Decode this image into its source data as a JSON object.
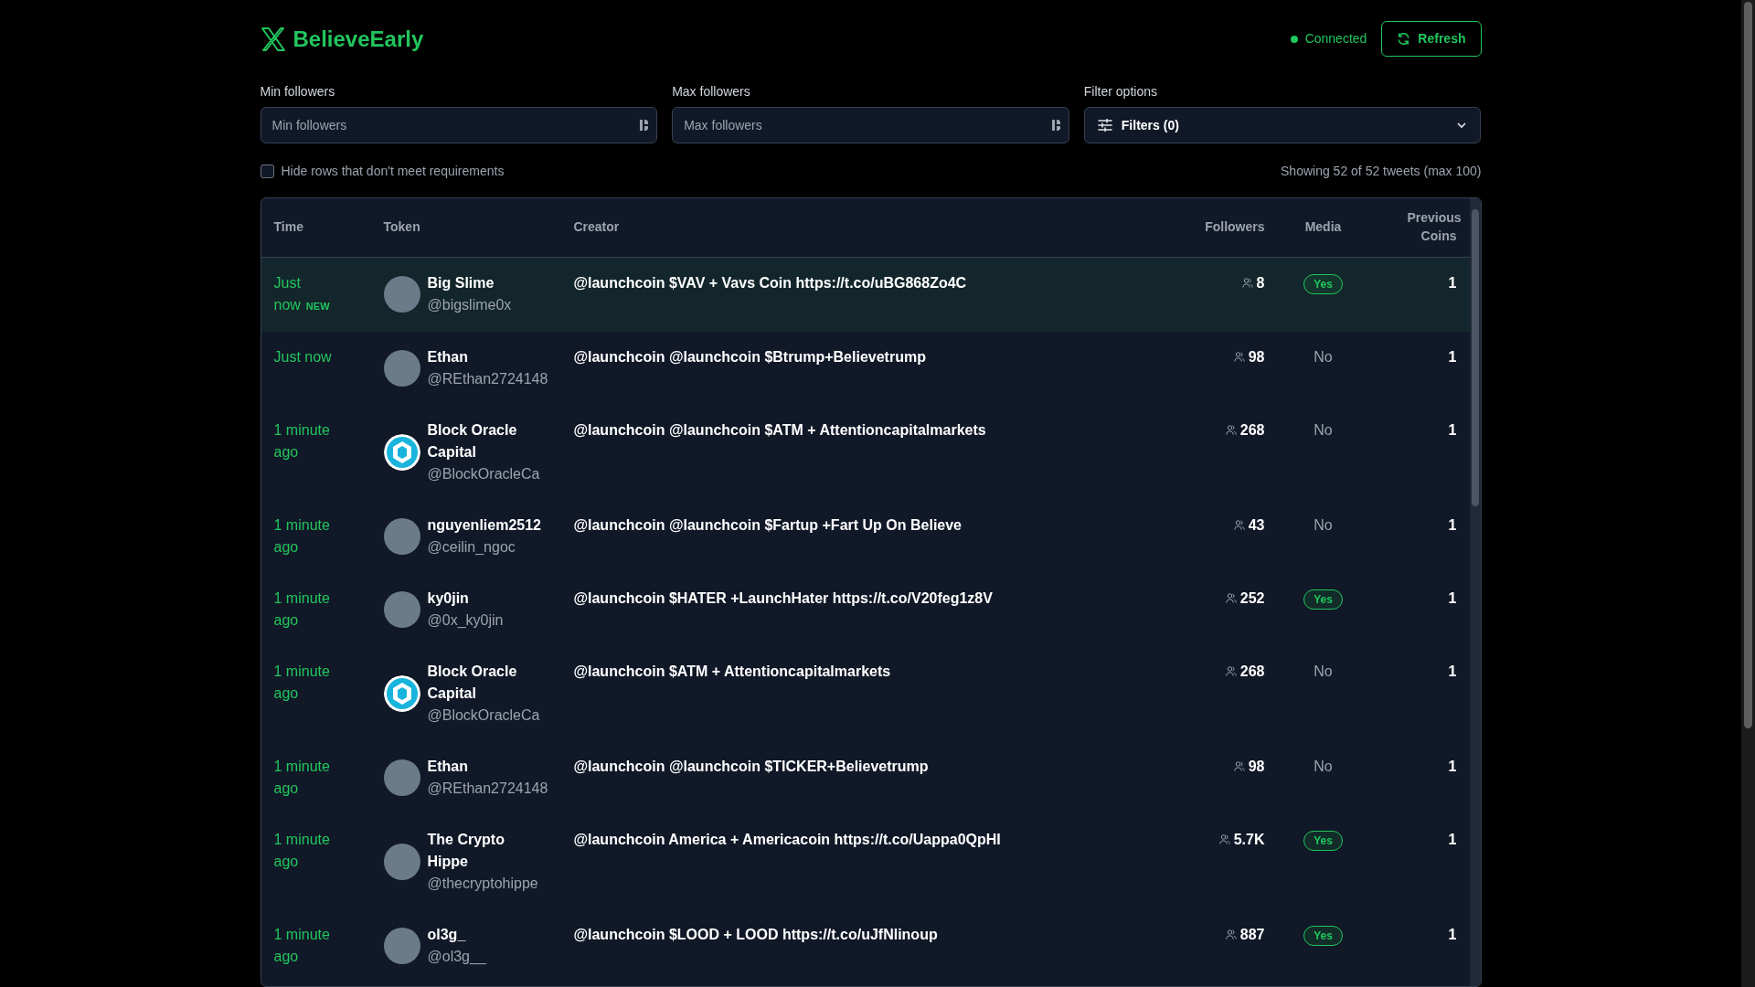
{
  "header": {
    "title": "BelieveEarly",
    "status": {
      "text": "Connected",
      "connected": true
    },
    "refresh_button": "Refresh"
  },
  "filters": [
    {
      "kind": "number",
      "label": "Min followers",
      "placeholder": "Min followers"
    },
    {
      "kind": "number",
      "label": "Max followers",
      "placeholder": "Max followers"
    },
    {
      "kind": "dropdown",
      "label": "Filter options",
      "value": "Filters (0)"
    }
  ],
  "hide_rows": {
    "label": "Hide rows that don't meet requirements",
    "checked": false
  },
  "summary": "Showing 52 of 52 tweets (max 100)",
  "table": {
    "columns": [
      "Time",
      "Token",
      "Creator",
      "Followers",
      "Media",
      "Previous Coins"
    ],
    "rows": [
      {
        "time": "Just now",
        "new_badge": "NEW",
        "highlighted": true,
        "avatar": {
          "kind": "photo"
        },
        "name": "Big Slime",
        "handle": "@bigslime0x",
        "tweet": "@launchcoin $VAV + Vavs Coin https://t.co/uBG868Zo4C",
        "followers": "8",
        "media": {
          "text": "Yes",
          "has_media": true
        },
        "previous_coins": "1"
      },
      {
        "time": "Just now",
        "highlighted": false,
        "avatar": {
          "kind": "photo"
        },
        "name": "Ethan",
        "handle": "@REthan2724148",
        "tweet": "@launchcoin @launchcoin $Btrump+Believetrump",
        "followers": "98",
        "media": {
          "text": "No",
          "has_media": false
        },
        "previous_coins": "1"
      },
      {
        "time": "1 minute ago",
        "highlighted": false,
        "avatar": {
          "kind": "logo"
        },
        "name": "Block Oracle Capital",
        "handle": "@BlockOracleCa",
        "tweet": "@launchcoin @launchcoin $ATM + Attentioncapitalmarkets",
        "followers": "268",
        "media": {
          "text": "No",
          "has_media": false
        },
        "previous_coins": "1"
      },
      {
        "time": "1 minute ago",
        "highlighted": false,
        "avatar": {
          "kind": "photo"
        },
        "name": "nguyenliem2512",
        "handle": "@ceilin_ngoc",
        "tweet": "@launchcoin @launchcoin $Fartup +Fart Up On Believe",
        "followers": "43",
        "media": {
          "text": "No",
          "has_media": false
        },
        "previous_coins": "1"
      },
      {
        "time": "1 minute ago",
        "highlighted": false,
        "avatar": {
          "kind": "photo"
        },
        "name": "ky0jin",
        "handle": "@0x_ky0jin",
        "tweet": "@launchcoin $HATER +LaunchHater https://t.co/V20feg1z8V",
        "followers": "252",
        "media": {
          "text": "Yes",
          "has_media": true
        },
        "previous_coins": "1"
      },
      {
        "time": "1 minute ago",
        "highlighted": false,
        "avatar": {
          "kind": "logo"
        },
        "name": "Block Oracle Capital",
        "handle": "@BlockOracleCa",
        "tweet": "@launchcoin $ATM + Attentioncapitalmarkets",
        "followers": "268",
        "media": {
          "text": "No",
          "has_media": false
        },
        "previous_coins": "1"
      },
      {
        "time": "1 minute ago",
        "highlighted": false,
        "avatar": {
          "kind": "photo"
        },
        "name": "Ethan",
        "handle": "@REthan2724148",
        "tweet": "@launchcoin @launchcoin $TICKER+Believetrump",
        "followers": "98",
        "media": {
          "text": "No",
          "has_media": false
        },
        "previous_coins": "1"
      },
      {
        "time": "1 minute ago",
        "highlighted": false,
        "avatar": {
          "kind": "photo"
        },
        "name": "The Crypto Hippe",
        "handle": "@thecryptohippe",
        "tweet": "@launchcoin America + Americacoin https://t.co/Uappa0QpHI",
        "followers": "5.7K",
        "media": {
          "text": "Yes",
          "has_media": true
        },
        "previous_coins": "1"
      },
      {
        "time": "1 minute ago",
        "highlighted": false,
        "avatar": {
          "kind": "photo"
        },
        "name": "ol3g_",
        "handle": "@ol3g__",
        "tweet": "@launchcoin $LOOD + LOOD https://t.co/uJfNlinoup",
        "followers": "887",
        "media": {
          "text": "Yes",
          "has_media": true
        },
        "previous_coins": "1"
      }
    ]
  }
}
